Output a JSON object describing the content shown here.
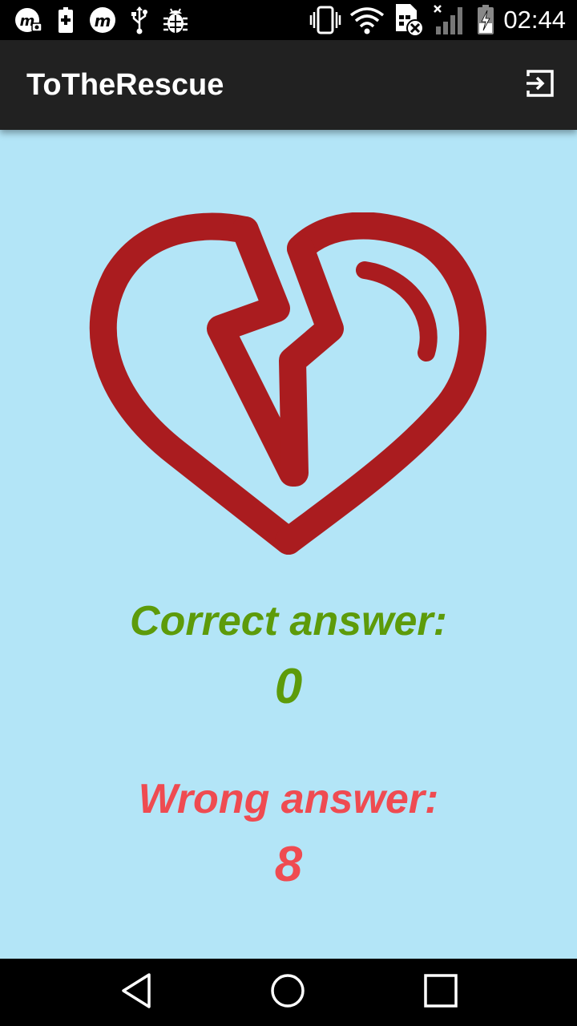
{
  "status_bar": {
    "time": "02:44",
    "left_icons": [
      "m-camera-icon",
      "battery-saver-icon",
      "m-icon",
      "usb-icon",
      "bug-icon"
    ],
    "right_icons": [
      "vibrate-icon",
      "wifi-icon",
      "sim-error-icon",
      "signal-icon",
      "battery-charging-icon"
    ]
  },
  "app_bar": {
    "title": "ToTheRescue",
    "action_icon": "logout-icon"
  },
  "result": {
    "heart_icon": "broken-heart-icon",
    "correct_label": "Correct answer:",
    "correct_value": "0",
    "wrong_label": "Wrong answer:",
    "wrong_value": "8"
  },
  "colors": {
    "background": "#b3e5f7",
    "app_bar": "#212121",
    "heart": "#aa1c1f",
    "correct": "#5d9b0a",
    "wrong": "#ef4b51"
  },
  "nav_bar": {
    "buttons": [
      "back-icon",
      "home-icon",
      "recents-icon"
    ]
  }
}
